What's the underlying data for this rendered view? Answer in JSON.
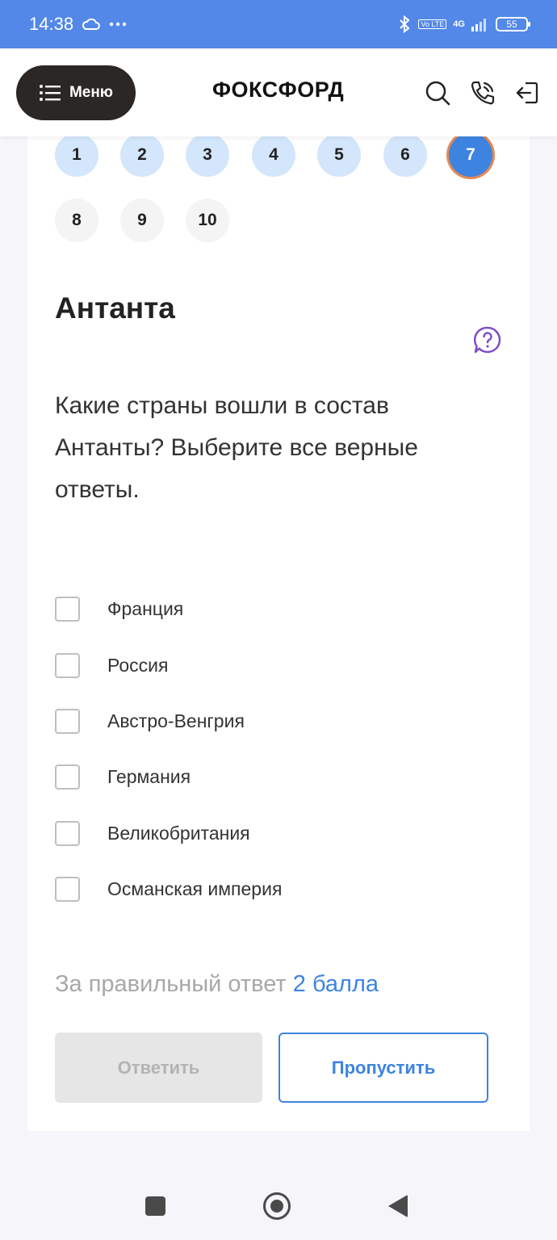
{
  "status_bar": {
    "time": "14:38",
    "battery": "55",
    "network": "4G",
    "volte": "Vo LTE"
  },
  "header": {
    "menu_label": "Меню",
    "logo": "ФОКСФОРД",
    "icons": [
      "search-icon",
      "phone-icon",
      "logout-icon"
    ]
  },
  "question_nav": {
    "items": [
      {
        "num": "1",
        "state": "done"
      },
      {
        "num": "2",
        "state": "done"
      },
      {
        "num": "3",
        "state": "done"
      },
      {
        "num": "4",
        "state": "done"
      },
      {
        "num": "5",
        "state": "done"
      },
      {
        "num": "6",
        "state": "done"
      },
      {
        "num": "7",
        "state": "current"
      },
      {
        "num": "8",
        "state": "todo"
      },
      {
        "num": "9",
        "state": "todo"
      },
      {
        "num": "10",
        "state": "todo"
      }
    ]
  },
  "task": {
    "title": "Антанта",
    "question": "Какие страны вошли в состав Антанты? Выберите все верные ответы.",
    "options": [
      {
        "label": "Франция",
        "checked": false
      },
      {
        "label": "Россия",
        "checked": false
      },
      {
        "label": "Австро-Венгрия",
        "checked": false
      },
      {
        "label": "Германия",
        "checked": false
      },
      {
        "label": "Великобритания",
        "checked": false
      },
      {
        "label": "Османская империя",
        "checked": false
      }
    ],
    "score_prefix": "За правильный ответ",
    "score_value": "2 балла",
    "answer_label": "Ответить",
    "skip_label": "Пропустить"
  },
  "colors": {
    "status_bar": "#5388e8",
    "accent": "#3d84e0",
    "done_bubble": "#d3e6fb",
    "current_ring": "#e38a55",
    "help_icon": "#7e4fc4"
  }
}
